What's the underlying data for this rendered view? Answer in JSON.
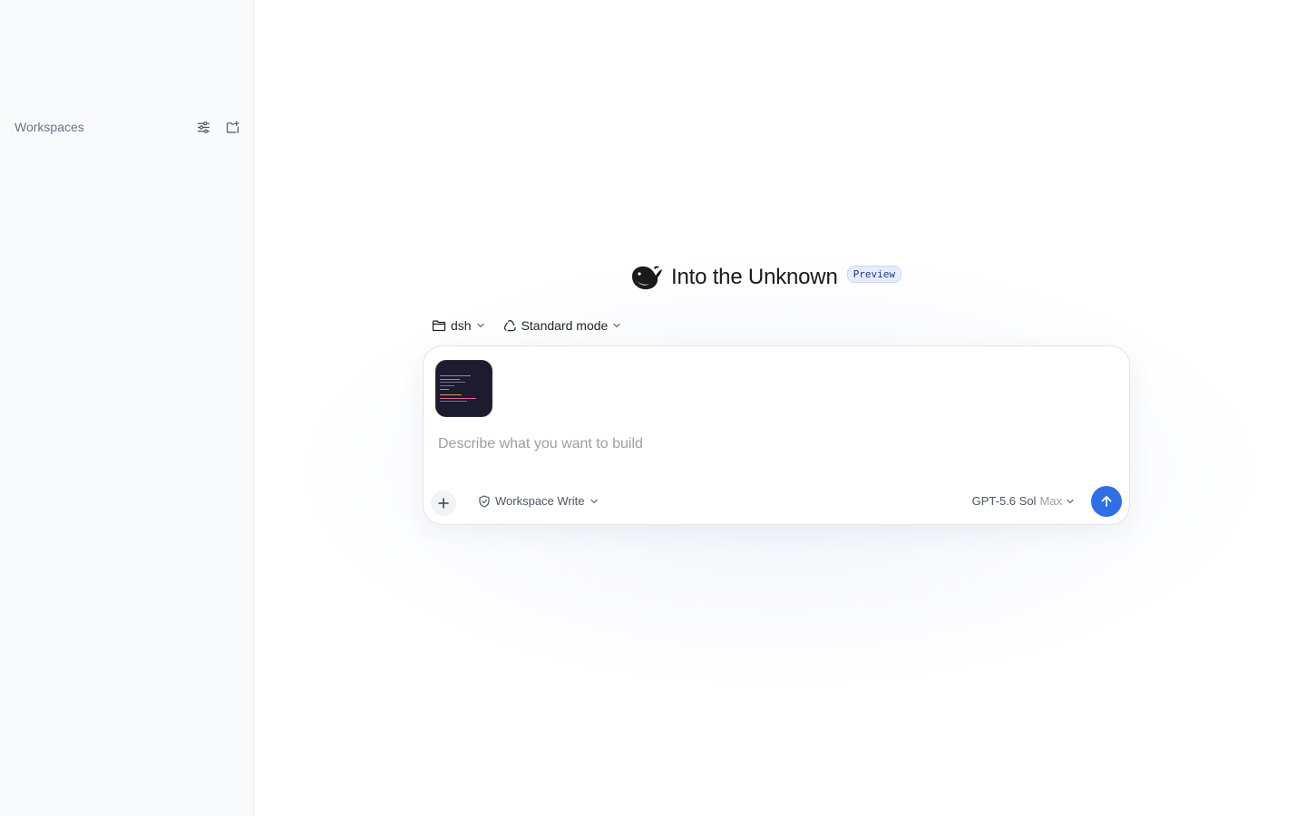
{
  "sidebar": {
    "workspaces_title": "Workspaces",
    "actions": [
      {
        "name": "filter-settings",
        "icon": "sliders-icon"
      },
      {
        "name": "new-workspace",
        "icon": "folder-plus-icon"
      }
    ]
  },
  "hero": {
    "logo_icon": "whale-icon",
    "title": "Into the Unknown",
    "badge": "Preview"
  },
  "selectors": {
    "folder": {
      "label": "dsh",
      "icon": "folder-icon"
    },
    "mode": {
      "label": "Standard mode",
      "icon": "recycle-icon"
    }
  },
  "composer": {
    "attachment": {
      "kind": "image-thumbnail",
      "description": "terminal screenshot"
    },
    "prompt_value": "",
    "placeholder": "Describe what you want to build",
    "permission": {
      "label": "Workspace Write",
      "icon": "shield-check-icon"
    },
    "model": {
      "name": "GPT-5.6 Sol",
      "effort": "Max"
    },
    "send_icon": "arrow-up-icon",
    "add_icon": "plus-icon"
  },
  "colors": {
    "accent": "#2f6fe4",
    "sidebar_bg": "#f8fafc",
    "badge_bg": "#e6ecfa",
    "badge_text": "#1e3a8a",
    "thumbnail_bg": "#1d1b2e"
  }
}
